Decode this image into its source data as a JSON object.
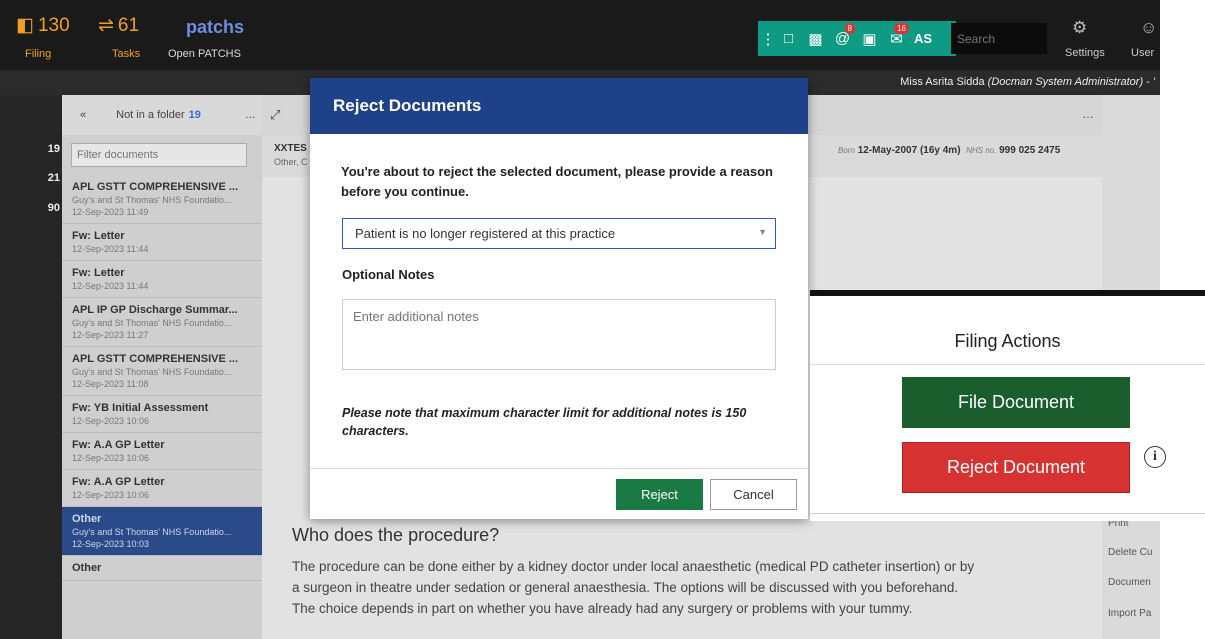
{
  "topbar": {
    "filing_count": "130",
    "filing_label": "Filing",
    "tasks_count": "61",
    "tasks_label": "Tasks",
    "patchs_logo": "patchs",
    "patchs_label": "Open PATCHS",
    "toolbar": {
      "badge_mentions": "8",
      "badge_messages": "16",
      "initials": "AS"
    },
    "search_placeholder": "Search",
    "settings_label": "Settings",
    "user_label": "User"
  },
  "userstrip": {
    "user_name": "Miss Asrita Sidda",
    "user_role": "(Docman System Administrator) - '"
  },
  "leftnav": {
    "counts": [
      "19",
      "21",
      "90"
    ]
  },
  "doclist": {
    "folder_label": "Not in a folder",
    "folder_count": "19",
    "filter_placeholder": "Filter documents",
    "items": [
      {
        "title": "APL GSTT COMPREHENSIVE ...",
        "org": "Guy's and St Thomas' NHS Foundatio...",
        "date": "12-Sep-2023 11:49"
      },
      {
        "title": "Fw: Letter",
        "org": "",
        "date": "12-Sep-2023 11:44"
      },
      {
        "title": "Fw: Letter",
        "org": "",
        "date": "12-Sep-2023 11:44"
      },
      {
        "title": "APL IP GP Discharge Summar...",
        "org": "Guy's and St Thomas' NHS Foundatio...",
        "date": "12-Sep-2023 11:27"
      },
      {
        "title": "APL GSTT COMPREHENSIVE ...",
        "org": "Guy's and St Thomas' NHS Foundatio...",
        "date": "12-Sep-2023 11:08"
      },
      {
        "title": "Fw: YB Initial Assessment",
        "org": "",
        "date": "12-Sep-2023 10:06"
      },
      {
        "title": "Fw: A.A GP Letter",
        "org": "",
        "date": "12-Sep-2023 10:06"
      },
      {
        "title": "Fw: A.A GP Letter",
        "org": "",
        "date": "12-Sep-2023 10:06"
      },
      {
        "title": "Other",
        "org": "Guy's and St Thomas' NHS Foundatio...",
        "date": "12-Sep-2023 10:03"
      },
      {
        "title": "Other",
        "org": "",
        "date": ""
      }
    ]
  },
  "viewer": {
    "patient_id": "XXTES",
    "patient_sub": "Other, C",
    "dob_label": "Born",
    "dob": "12-May-2007 (16y 4m)",
    "nhs_label": "NHS no.",
    "nhs_no": "999 025 2475",
    "heading": "Who does the procedure?",
    "paragraph_1": "The procedure can be done either by a kidney doctor under local anaesthetic (medical PD catheter insertion) or by",
    "paragraph_2": "a surgeon in theatre under sedation or general anaesthesia. The options will be discussed with you beforehand.",
    "paragraph_3": "The choice depends in part on whether you have already had any surgery or problems with your tummy."
  },
  "rightpanel": {
    "items": [
      "Print",
      "Delete Cu",
      "Documen",
      "Import Pa"
    ]
  },
  "modal": {
    "title": "Reject Documents",
    "message": "You're about to reject the selected document, please provide a reason before you continue.",
    "reason_value": "Patient is no longer registered at this practice",
    "notes_label": "Optional Notes",
    "notes_placeholder": "Enter additional notes",
    "char_limit_note": "Please note that maximum character limit for additional notes is 150 characters.",
    "reject_label": "Reject",
    "cancel_label": "Cancel"
  },
  "filing_actions": {
    "title": "Filing Actions",
    "file_label": "File Document",
    "reject_label": "Reject Document"
  },
  "colors": {
    "modal_header": "#1f4189",
    "reject_green": "#1a7a43",
    "file_green": "#1a5e2e",
    "reject_red": "#d73232",
    "toolbar_teal": "#0f9b83",
    "counter_orange": "#f0a020"
  }
}
